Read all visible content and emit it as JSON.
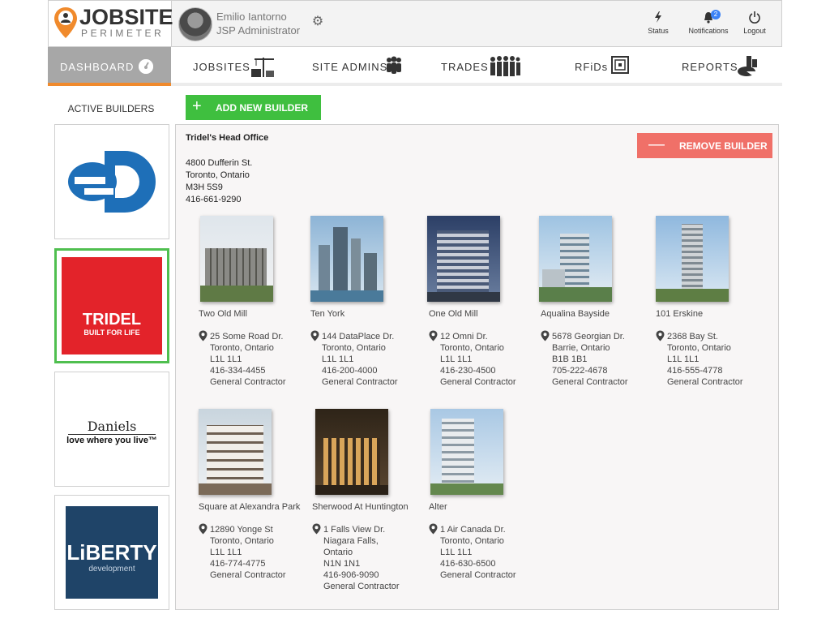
{
  "app": {
    "logo_title": "JOBSITE",
    "logo_sub": "PERIMETER"
  },
  "user": {
    "name": "Emilio Iantorno",
    "role": "JSP Administrator"
  },
  "header_actions": {
    "status_label": "Status",
    "notifications_label": "Notifications",
    "notifications_count": "2",
    "logout_label": "Logout"
  },
  "nav": {
    "dashboard": "DASHBOARD",
    "jobsites": "JOBSITES",
    "site_admins": "SITE ADMINS",
    "trades": "TRADES",
    "rfids": "RFiDs",
    "reports": "REPORTS"
  },
  "sidebar": {
    "title": "ACTIVE BUILDERS",
    "builders": [
      {
        "id": "ed",
        "selected": false
      },
      {
        "id": "tridel",
        "logo_text": "TRIDEL",
        "logo_tag": "BUILT FOR LIFE",
        "selected": true,
        "color": "#e3232a"
      },
      {
        "id": "daniels",
        "logo_text": "Daniels",
        "logo_tag": "love where you live™",
        "selected": false
      },
      {
        "id": "liberty",
        "logo_text": "LiBERTY",
        "logo_tag": "development",
        "selected": false,
        "color": "#1f4468"
      }
    ]
  },
  "actions": {
    "add_builder": "ADD NEW BUILDER",
    "remove_builder": "REMOVE BUILDER"
  },
  "office": {
    "title": "Tridel's Head Office",
    "street": "4800 Dufferin St.",
    "city": "Toronto, Ontario",
    "postal": "M3H 5S9",
    "phone": "416-661-9290"
  },
  "sites": [
    {
      "name": "Two Old Mill",
      "street": "25 Some Road Dr.",
      "city": "Toronto, Ontario",
      "postal": "L1L 1L1",
      "phone": "416-334-4455",
      "role": "General Contractor"
    },
    {
      "name": "Ten York",
      "street": "144 DataPlace Dr.",
      "city": "Toronto, Ontario",
      "postal": "L1L 1L1",
      "phone": "416-200-4000",
      "role": "General Contractor"
    },
    {
      "name": "One Old Mill",
      "street": "12 Omni Dr.",
      "city": "Toronto, Ontario",
      "postal": "L1L 1L1",
      "phone": "416-230-4500",
      "role": "General Contractor"
    },
    {
      "name": "Aqualina Bayside",
      "street": "5678 Georgian Dr.",
      "city": "Barrie, Ontario",
      "postal": "B1B 1B1",
      "phone": "705-222-4678",
      "role": "General Contractor"
    },
    {
      "name": "101 Erskine",
      "street": "2368 Bay St.",
      "city": "Toronto, Ontario",
      "postal": "L1L 1L1",
      "phone": "416-555-4778",
      "role": "General Contractor"
    },
    {
      "name": "Square at Alexandra Park",
      "street": "12890 Yonge St",
      "city": "Toronto, Ontario",
      "postal": "L1L 1L1",
      "phone": "416-774-4775",
      "role": "General Contractor"
    },
    {
      "name": "Sherwood At Huntington",
      "street": "1 Falls View Dr.",
      "city": "Niagara Falls, Ontario",
      "postal": "N1N 1N1",
      "phone": "416-906-9090",
      "role": "General Contractor"
    },
    {
      "name": "Alter",
      "street": "1 Air Canada Dr.",
      "city": "Toronto, Ontario",
      "postal": "L1L 1L1",
      "phone": "416-630-6500",
      "role": "General Contractor"
    }
  ],
  "colors": {
    "accent_orange": "#f08a2c",
    "add_green": "#3fbf3f",
    "remove_red": "#f07068",
    "selected_border": "#4fbf4f"
  }
}
